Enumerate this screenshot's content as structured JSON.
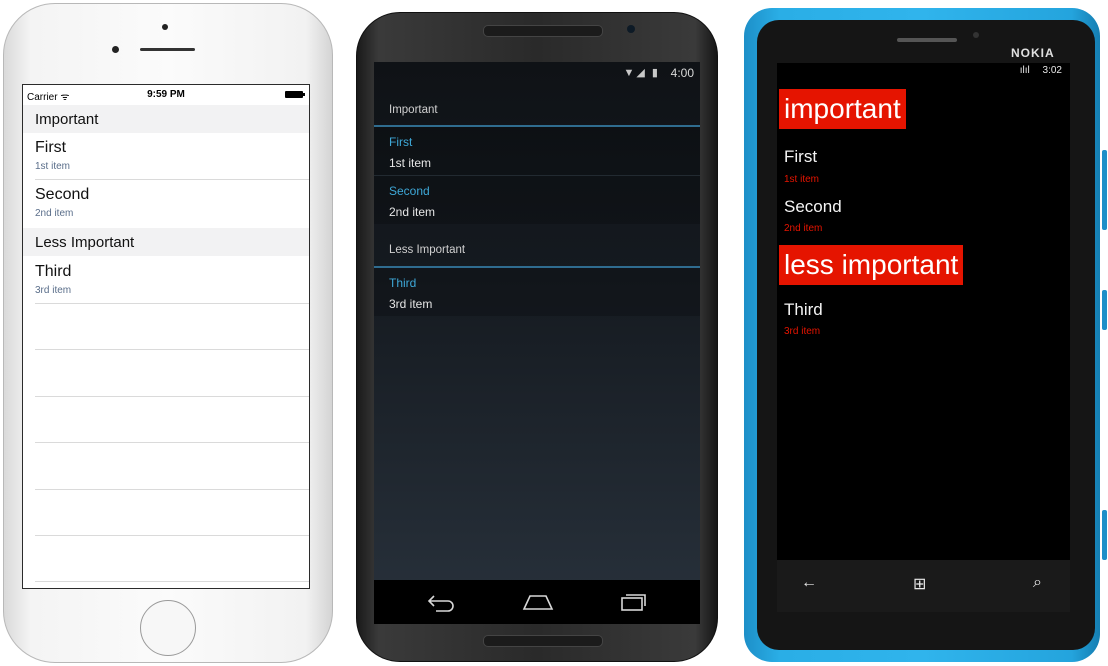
{
  "ios": {
    "status": {
      "carrier": "Carrier ᯤ",
      "time": "9:59 PM"
    },
    "groups": [
      {
        "header": "Important",
        "items": [
          {
            "title": "First",
            "detail": "1st item"
          },
          {
            "title": "Second",
            "detail": "2nd item"
          }
        ]
      },
      {
        "header": "Less Important",
        "items": [
          {
            "title": "Third",
            "detail": "3rd item"
          }
        ]
      }
    ]
  },
  "android": {
    "status": {
      "time": "4:00",
      "icons": "▼◢ ▮"
    },
    "groups": [
      {
        "header": "Important",
        "items": [
          {
            "title": "First",
            "detail": "1st item"
          },
          {
            "title": "Second",
            "detail": "2nd item"
          }
        ]
      },
      {
        "header": "Less Important",
        "items": [
          {
            "title": "Third",
            "detail": "3rd item"
          }
        ]
      }
    ],
    "nav": {
      "back_icon": "back-icon",
      "home_icon": "home-icon",
      "recents_icon": "recents-icon"
    }
  },
  "windows_phone": {
    "brand": "NOKIA",
    "status": {
      "signal": "ılıl",
      "time": "3:02"
    },
    "groups": [
      {
        "header": "important",
        "items": [
          {
            "title": "First",
            "detail": "1st item"
          },
          {
            "title": "Second",
            "detail": "2nd item"
          }
        ]
      },
      {
        "header": "less important",
        "items": [
          {
            "title": "Third",
            "detail": "3rd item"
          }
        ]
      }
    ],
    "appbar": {
      "back": "←",
      "start": "⊞",
      "search": "⌕"
    }
  },
  "colors": {
    "ios_detail": "#5a6e8a",
    "android_accent": "#3ea8d8",
    "wp_accent": "#e51400",
    "nokia_body": "#2aaee6"
  }
}
